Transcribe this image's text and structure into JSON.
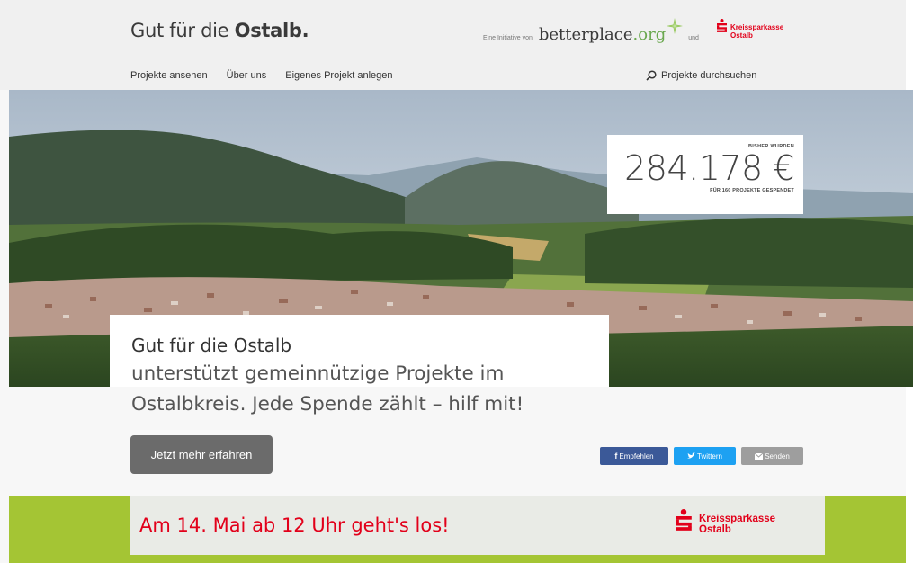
{
  "header": {
    "logo_prefix": "Gut für die ",
    "logo_bold": "Ostalb.",
    "initiative_prefix": "Eine Initiative von",
    "betterplace_main": "betterplace",
    "betterplace_tld": ".org",
    "und": "und",
    "sparkasse_line1": "Kreissparkasse",
    "sparkasse_line2": "Ostalb"
  },
  "nav": {
    "items": [
      "Projekte ansehen",
      "Über uns",
      "Eigenes Projekt anlegen"
    ],
    "search_label": "Projekte durchsuchen"
  },
  "counter": {
    "top": "BISHER WURDEN",
    "amount": "284.178 €",
    "bottom": "FÜR 160 PROJEKTE GESPENDET"
  },
  "intro": {
    "title": "Gut für die Ostalb",
    "line1": "unterstützt gemeinnützige Projekte im",
    "line2": "Ostalbkreis. Jede Spende zählt – hilf mit!"
  },
  "cta": {
    "label": "Jetzt mehr erfahren"
  },
  "social": {
    "facebook": "Empfehlen",
    "twitter": "Twittern",
    "mail": "Senden"
  },
  "banner": {
    "launch": "Am 14. Mai ab 12 Uhr geht's los!",
    "sparkasse_line1": "Kreissparkasse",
    "sparkasse_line2": "Ostalb"
  },
  "colors": {
    "brand_red": "#e2001a",
    "banner_green": "#a4c534",
    "facebook_blue": "#3b5998",
    "twitter_blue": "#1da1f2"
  },
  "icons": [
    "search-icon",
    "betterplace-star-icon",
    "sparkasse-logo-icon",
    "facebook-icon",
    "twitter-icon",
    "mail-icon"
  ]
}
